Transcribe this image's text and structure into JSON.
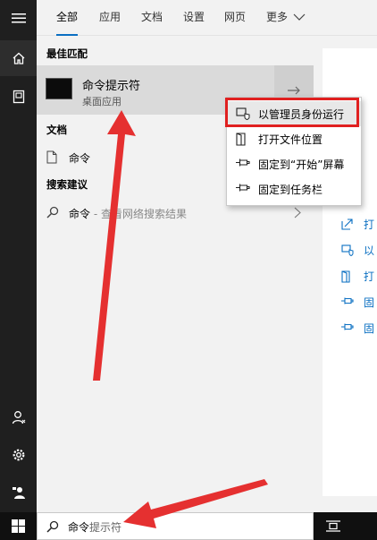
{
  "tabs": [
    {
      "label": "全部",
      "active": true
    },
    {
      "label": "应用"
    },
    {
      "label": "文档"
    },
    {
      "label": "设置"
    },
    {
      "label": "网页"
    },
    {
      "label": "更多"
    }
  ],
  "best_match": {
    "title": "最佳匹配",
    "name": "命令提示符",
    "subtitle": "桌面应用"
  },
  "documents": {
    "title": "文档",
    "items": [
      {
        "label": "命令"
      }
    ]
  },
  "suggestions": {
    "title": "搜索建议",
    "items": [
      {
        "label": "命令",
        "sub": " - 查看网络搜索结果"
      }
    ]
  },
  "context_menu": [
    {
      "label": "以管理员身份运行",
      "icon": "shield-run-icon",
      "highlighted": true
    },
    {
      "label": "打开文件位置",
      "icon": "folder-open-icon"
    },
    {
      "label": "固定到“开始”屏幕",
      "icon": "pin-icon"
    },
    {
      "label": "固定到任务栏",
      "icon": "pin-icon"
    }
  ],
  "detail_actions": [
    {
      "label": "打",
      "icon": "open-icon"
    },
    {
      "label": "以",
      "icon": "shield-run-icon"
    },
    {
      "label": "打",
      "icon": "folder-open-icon"
    },
    {
      "label": "固",
      "icon": "pin-icon"
    },
    {
      "label": "固",
      "icon": "pin-icon"
    }
  ],
  "search": {
    "typed": "命令",
    "suggested": "提示符"
  },
  "colors": {
    "accent": "#0a6fc2",
    "annotation": "#e02020",
    "rail": "#1f1f1f",
    "taskbar": "#101010"
  }
}
